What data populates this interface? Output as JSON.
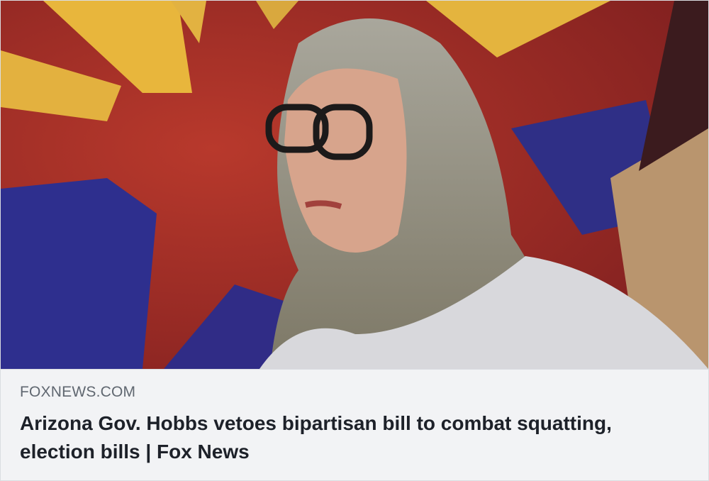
{
  "link_preview": {
    "image_alt": "Arizona Gov. Katie Hobbs in front of Arizona flag",
    "domain": "FOXNEWS.COM",
    "title": "Arizona Gov. Hobbs vetoes bipartisan bill to combat squatting, election bills | Fox News"
  },
  "colors": {
    "meta_background": "#f2f3f5",
    "title": "#1d2129",
    "domain": "#606770",
    "border": "#dadde1"
  }
}
